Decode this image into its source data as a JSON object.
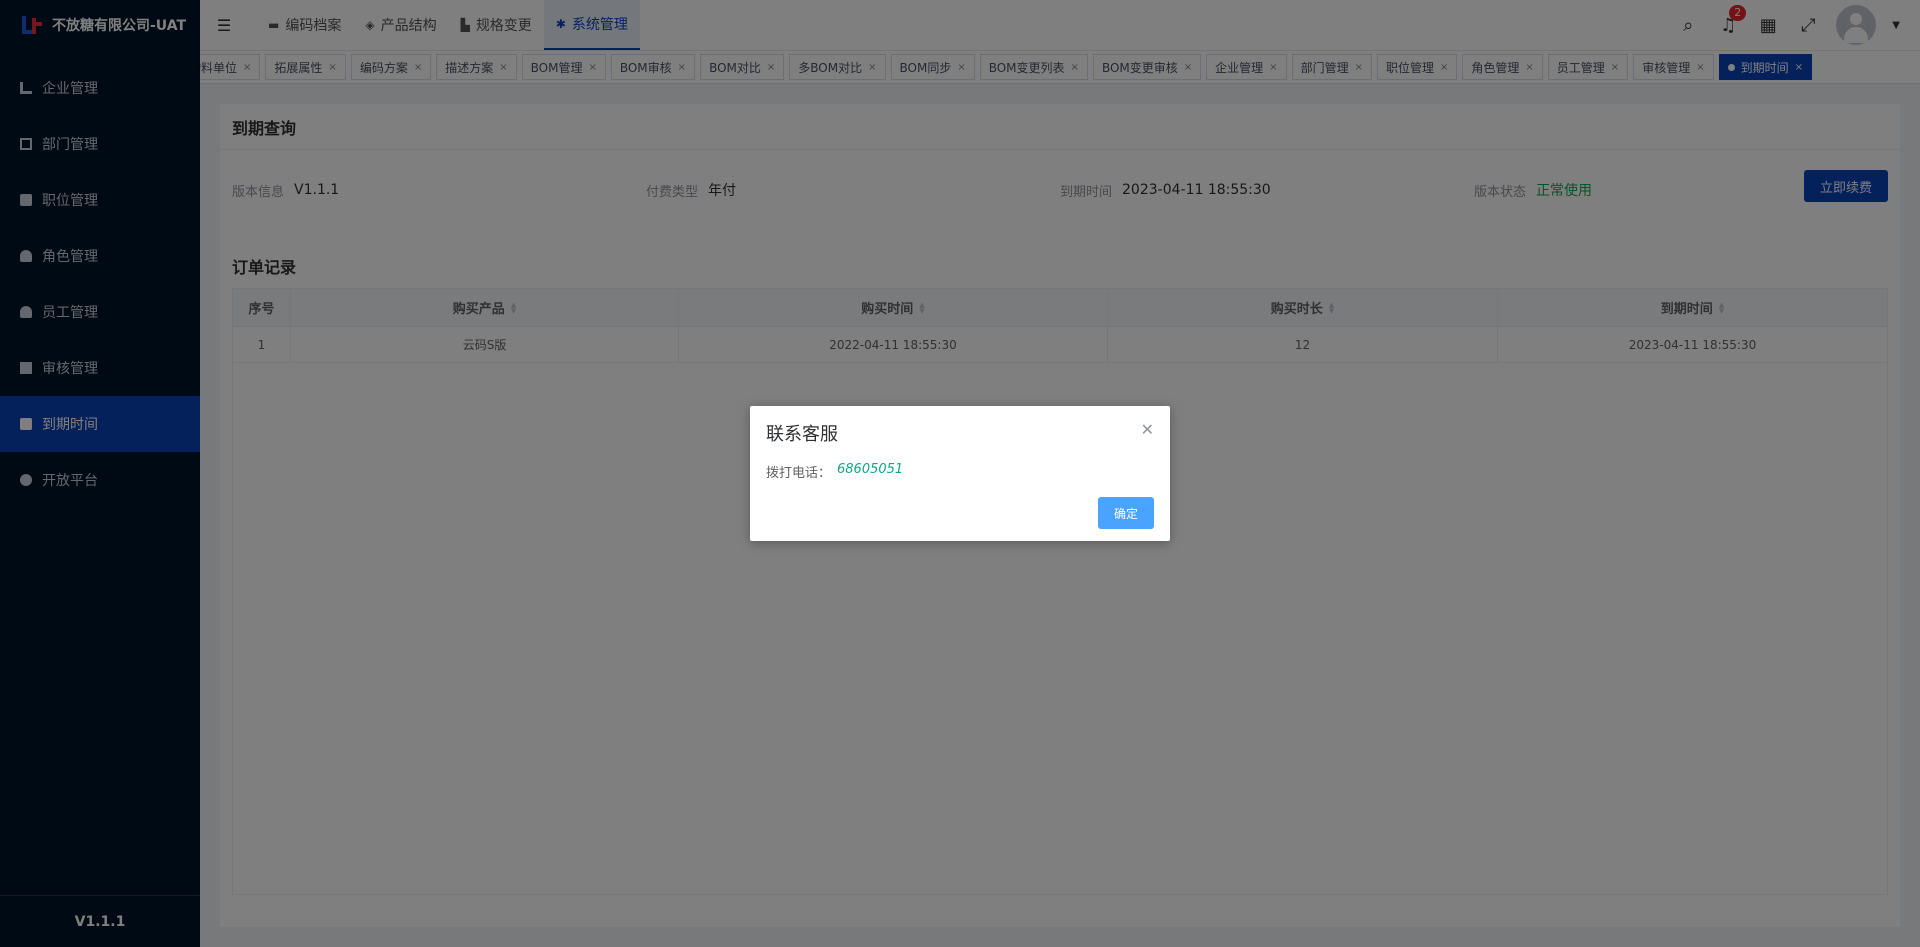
{
  "app": {
    "title": "不放糖有限公司-UAT",
    "version": "V1.1.1"
  },
  "sidebar": {
    "items": [
      {
        "label": "企业管理",
        "icon": "building-icon"
      },
      {
        "label": "部门管理",
        "icon": "tree-icon"
      },
      {
        "label": "职位管理",
        "icon": "id-card-icon"
      },
      {
        "label": "角色管理",
        "icon": "role-icon"
      },
      {
        "label": "员工管理",
        "icon": "user-icon"
      },
      {
        "label": "审核管理",
        "icon": "check-square-icon"
      },
      {
        "label": "到期时间",
        "icon": "calendar-icon"
      },
      {
        "label": "开放平台",
        "icon": "headset-icon"
      }
    ],
    "active": "到期时间"
  },
  "topnav": {
    "items": [
      {
        "label": "编码档案",
        "icon": "folder-icon"
      },
      {
        "label": "产品结构",
        "icon": "layers-icon"
      },
      {
        "label": "规格变更",
        "icon": "chart-icon"
      },
      {
        "label": "系统管理",
        "icon": "gear-icon"
      }
    ],
    "active": "系统管理",
    "notification_count": "2"
  },
  "tags": [
    "物料单位",
    "拓展属性",
    "编码方案",
    "描述方案",
    "BOM管理",
    "BOM审核",
    "BOM对比",
    "多BOM对比",
    "BOM同步",
    "BOM变更列表",
    "BOM变更审核",
    "企业管理",
    "部门管理",
    "职位管理",
    "角色管理",
    "员工管理",
    "审核管理",
    "到期时间"
  ],
  "active_tag": "到期时间",
  "expire": {
    "title": "到期查询",
    "version_label": "版本信息",
    "version_value": "V1.1.1",
    "pay_label": "付费类型",
    "pay_value": "年付",
    "expire_label": "到期时间",
    "expire_value": "2023-04-11 18:55:30",
    "status_label": "版本状态",
    "status_value": "正常使用",
    "renew_button": "立即续费"
  },
  "orders": {
    "title": "订单记录",
    "columns": [
      "序号",
      "购买产品",
      "购买时间",
      "购买时长",
      "到期时间"
    ],
    "rows": [
      [
        "1",
        "云码S版",
        "2022-04-11 18:55:30",
        "12",
        "2023-04-11 18:55:30"
      ]
    ]
  },
  "dialog": {
    "title": "联系客服",
    "label": "拨打电话：",
    "phone": "68605051",
    "ok": "确定"
  },
  "colors": {
    "primary": "#0b43b8",
    "sidebar": "#001529",
    "success": "#13a35a",
    "phone": "#13a38c",
    "dialog_ok": "#4aa3ff"
  }
}
